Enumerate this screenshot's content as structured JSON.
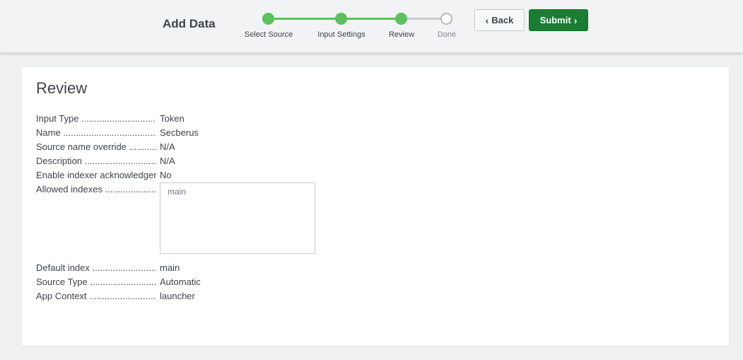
{
  "header": {
    "title": "Add Data",
    "steps": [
      {
        "label": "Select Source",
        "status": "done"
      },
      {
        "label": "Input Settings",
        "status": "done"
      },
      {
        "label": "Review",
        "status": "done"
      },
      {
        "label": "Done",
        "status": "todo"
      }
    ],
    "back_label": "Back",
    "submit_label": "Submit"
  },
  "review": {
    "title": "Review",
    "fields": [
      {
        "label": "Input Type .............................................",
        "value": "Token"
      },
      {
        "label": "Name ...................................................",
        "value": "Secberus"
      },
      {
        "label": "Source name override ...............................",
        "value": "N/A"
      },
      {
        "label": "Description ............................................",
        "value": "N/A"
      },
      {
        "label": "Enable indexer acknowledgement ....................",
        "value": "No"
      },
      {
        "label": "Allowed indexes ......................................",
        "value": ""
      },
      {
        "label": "Default index ...........................................",
        "value": "main"
      },
      {
        "label": "Source Type ..............................................",
        "value": "Automatic"
      },
      {
        "label": "App Context ..............................................",
        "value": "launcher"
      }
    ],
    "allowed_indexes": [
      "main"
    ]
  },
  "colors": {
    "accent_green": "#5cc05c",
    "submit_green": "#1a7d33",
    "inactive_step": "#c3cbd4"
  }
}
